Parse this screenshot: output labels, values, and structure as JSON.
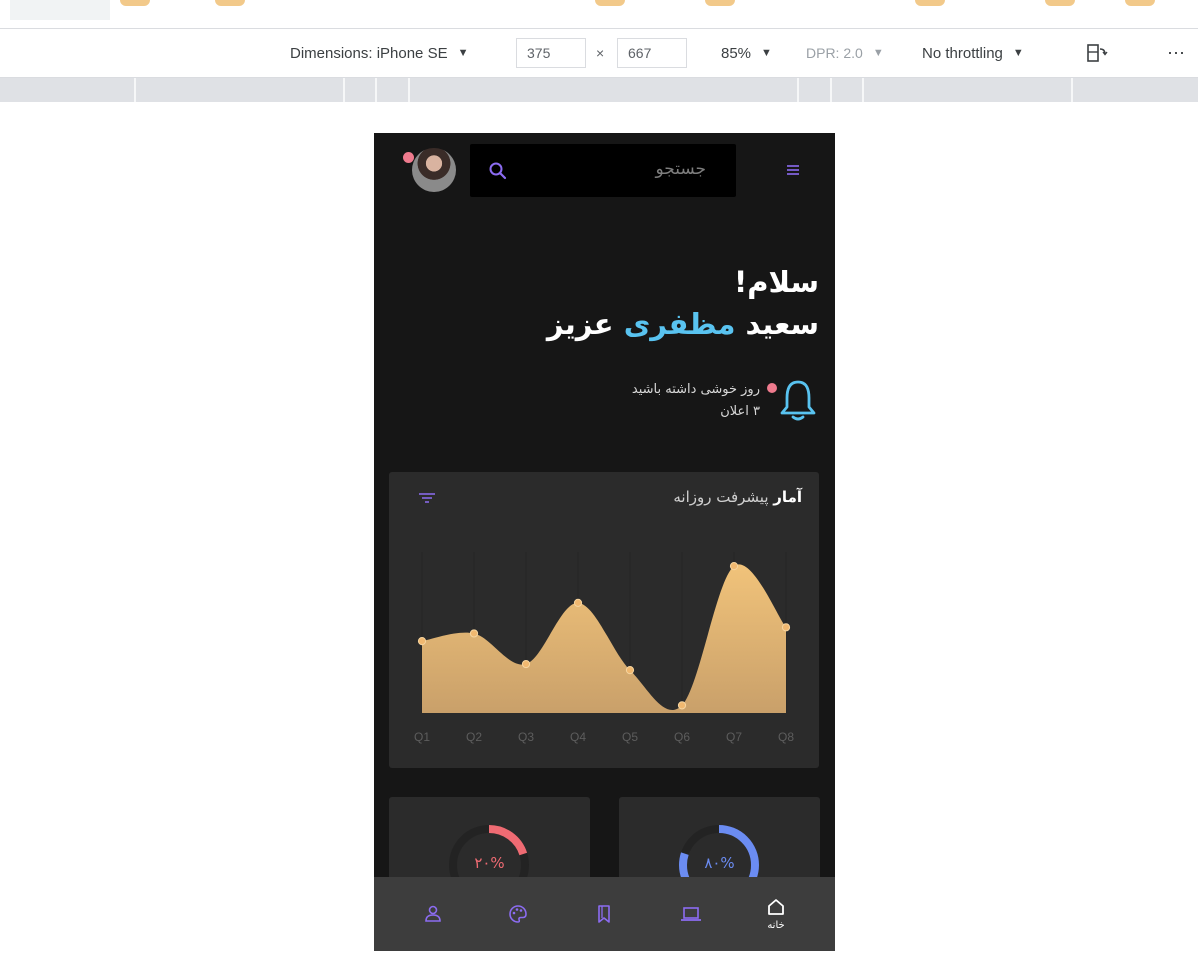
{
  "devtools": {
    "dimensions_label": "Dimensions: iPhone SE",
    "width_value": "375",
    "times": "×",
    "height_value": "667",
    "zoom": "85%",
    "dpr": "DPR: 2.0",
    "throttle": "No throttling",
    "more": "⋯"
  },
  "app": {
    "search_placeholder": "جستجو",
    "greeting": "سلام!",
    "name_first": "سعید",
    "name_highlight": "مظفری",
    "name_last": "عزیز",
    "notice_line1": "روز خوشی داشته باشید",
    "notice_line2": "۳ اعلان",
    "card_title_bold": "آمار",
    "card_title_rest": "پیشرفت روزانه",
    "mini_left_value": "۲۰%",
    "mini_right_value": "۸۰%",
    "nav_home_label": "خانه"
  },
  "colors": {
    "accent_blue": "#59c3f0",
    "accent_purple": "#8c6cf2",
    "chart_fill_top": "#f1c37a",
    "chart_fill_bottom": "#c9a06a",
    "ring_red": "#ef6b73",
    "ring_blue": "#6b8cf2",
    "dot_pink": "#ef7b8e"
  },
  "icons": [
    "menu-icon",
    "search-icon",
    "avatar",
    "bell-icon",
    "filter-icon",
    "user-icon",
    "palette-icon",
    "bookmark-icon",
    "laptop-icon",
    "home-icon"
  ],
  "chart_data": {
    "type": "area",
    "categories": [
      "Q1",
      "Q2",
      "Q3",
      "Q4",
      "Q5",
      "Q6",
      "Q7",
      "Q8"
    ],
    "values": [
      47,
      52,
      32,
      72,
      28,
      5,
      96,
      56
    ],
    "ylim": [
      0,
      100
    ],
    "grid": "vertical",
    "title": "",
    "xlabel": "",
    "ylabel": ""
  },
  "mini_charts": [
    {
      "percent": 20,
      "color": "#ef6b73"
    },
    {
      "percent": 80,
      "color": "#6b8cf2"
    }
  ]
}
